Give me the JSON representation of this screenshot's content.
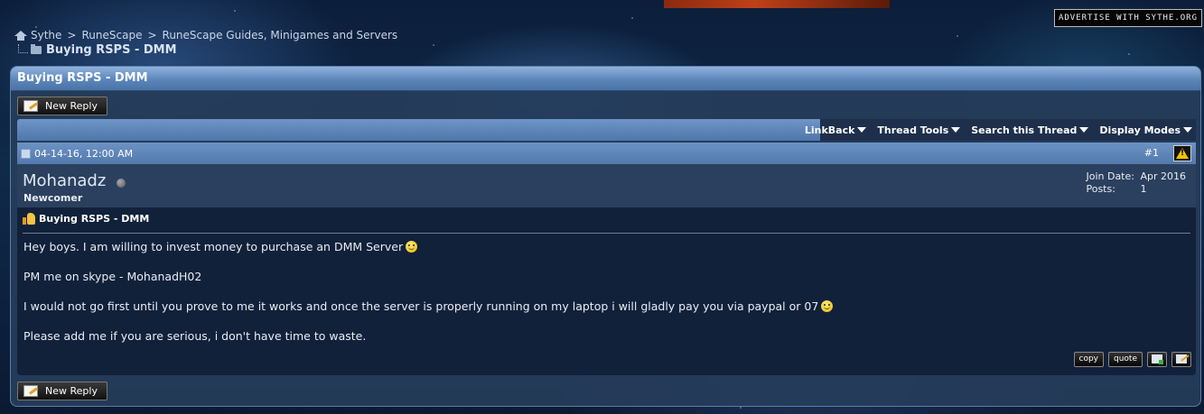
{
  "ad": {
    "text": "Advertise with Sythe.org"
  },
  "breadcrumb": {
    "items": [
      {
        "label": "Sythe"
      },
      {
        "label": "RuneScape"
      },
      {
        "label": "RuneScape Guides, Minigames and Servers"
      }
    ],
    "separator": ">",
    "current": "Buying RSPS - DMM"
  },
  "thread": {
    "title": "Buying RSPS - DMM",
    "new_reply_label": "New Reply"
  },
  "toolbar": {
    "linkback": "LinkBack",
    "thread_tools": "Thread Tools",
    "search_thread": "Search this Thread",
    "display_modes": "Display Modes"
  },
  "post": {
    "date": "04-14-16, 12:00 AM",
    "number": "#1",
    "username": "Mohanadz",
    "user_title": "Newcomer",
    "join_date_label": "Join Date:",
    "join_date": "Apr 2016",
    "posts_label": "Posts:",
    "posts": "1",
    "title": "Buying RSPS - DMM",
    "lines": [
      "Hey boys. I am willing to invest money to purchase an DMM Server",
      "PM me on skype - MohanadH02",
      "I would not go first until you prove to me it works and once the server is properly running on my laptop i will gladly pay you via paypal or 07",
      "Please add me if you are serious, i don't have time to waste."
    ],
    "actions": {
      "copy": "copy",
      "quote": "quote"
    }
  }
}
